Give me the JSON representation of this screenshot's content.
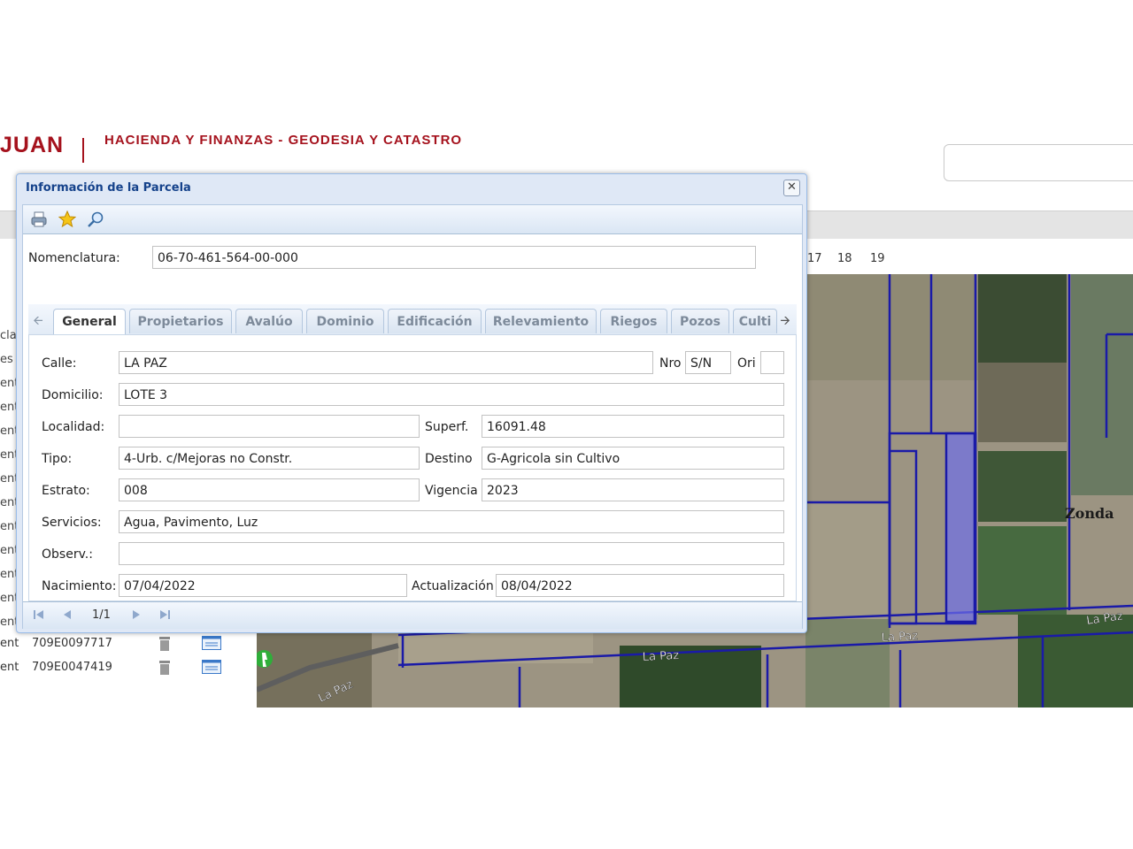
{
  "header": {
    "brand": "JUAN",
    "subtitle": "HACIENDA Y FINANZAS - GEODESIA Y CATASTRO"
  },
  "background": {
    "page_numbers": [
      "17",
      "18",
      "19"
    ],
    "left_labels": [
      "cla",
      "es",
      "ent",
      "ent",
      "ent",
      "ent",
      "ent",
      "ent",
      "ent",
      "ent",
      "ent",
      "ent",
      "ent"
    ],
    "rows": [
      {
        "prefix": "ent",
        "code": "709E0097717"
      },
      {
        "prefix": "ent",
        "code": "709E0047419"
      }
    ],
    "map_labels": {
      "zonda": "Zonda",
      "lapaz1": "La Paz",
      "lapaz2": "La Paz",
      "lapaz3": "La Paz",
      "lapaz4": "La Paz"
    }
  },
  "dialog": {
    "title": "Información de la Parcela",
    "close_symbol": "✕",
    "toolbar_icons": [
      "printer-icon",
      "star-icon",
      "magnifier-icon"
    ],
    "nomenclatura_label": "Nomenclatura:",
    "nomenclatura_value": "06-70-461-564-00-000",
    "tabs": [
      "General",
      "Propietarios",
      "Avalúo",
      "Dominio",
      "Edificación",
      "Relevamiento",
      "Riegos",
      "Pozos",
      "Culti"
    ],
    "active_tab": "General",
    "fields": {
      "calle_label": "Calle:",
      "calle_value": "LA PAZ",
      "nro_label": "Nro",
      "nro_value": "S/N",
      "ori_label": "Ori",
      "ori_value": "",
      "domicilio_label": "Domicilio:",
      "domicilio_value": "LOTE 3",
      "localidad_label": "Localidad:",
      "localidad_value": "",
      "superf_label": "Superf.",
      "superf_value": "16091.48",
      "tipo_label": "Tipo:",
      "tipo_value": "4-Urb. c/Mejoras no Constr.",
      "destino_label": "Destino",
      "destino_value": "G-Agricola sin Cultivo",
      "estrato_label": "Estrato:",
      "estrato_value": "008",
      "vigencia_label": "Vigencia",
      "vigencia_value": "2023",
      "servicios_label": "Servicios:",
      "servicios_value": "Agua, Pavimento, Luz",
      "observ_label": "Observ.:",
      "observ_value": "",
      "nacimiento_label": "Nacimiento:",
      "nacimiento_value": "07/04/2022",
      "actualizacion_label": "Actualización",
      "actualizacion_value": "08/04/2022"
    },
    "pager": {
      "page": "1/1"
    }
  },
  "colors": {
    "brand": "#a5121d",
    "parcel_border": "#1a1aa8",
    "parcel_fill": "#6f6fe8"
  }
}
